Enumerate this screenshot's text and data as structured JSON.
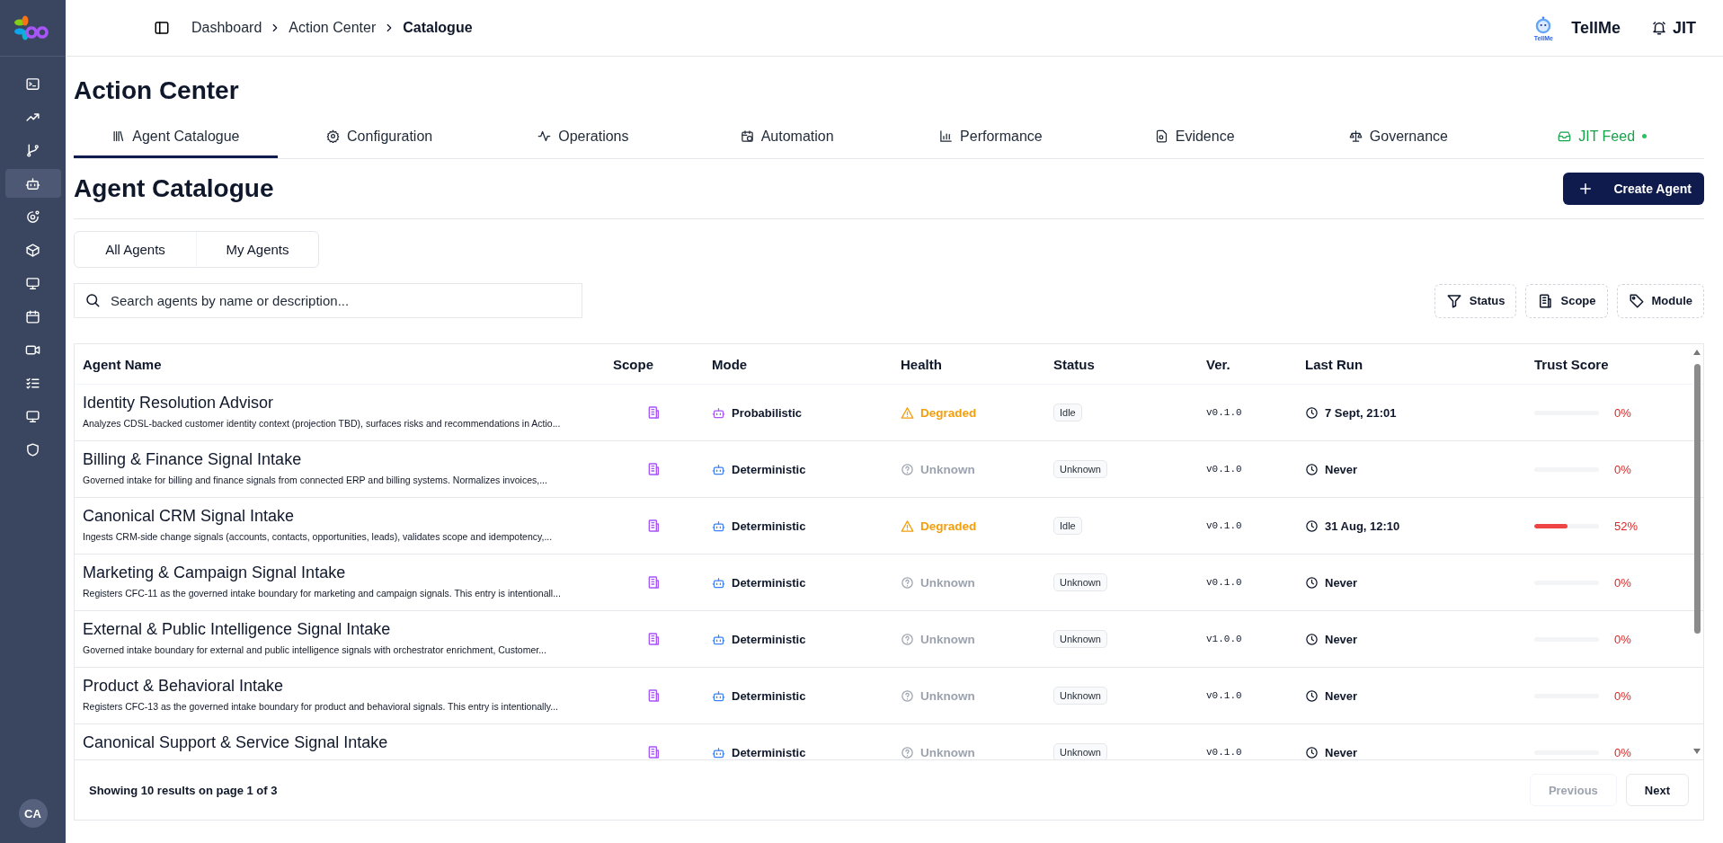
{
  "sidebar": {
    "items": [
      {
        "selected": false
      },
      {
        "selected": false
      },
      {
        "selected": false
      },
      {
        "selected": true
      },
      {
        "selected": false
      },
      {
        "selected": false
      },
      {
        "selected": false
      },
      {
        "selected": false
      },
      {
        "selected": false
      },
      {
        "selected": false
      },
      {
        "selected": false
      },
      {
        "selected": false
      }
    ],
    "avatar": "CA"
  },
  "breadcrumb": [
    {
      "label": "Dashboard",
      "current": false
    },
    {
      "label": "Action Center",
      "current": false
    },
    {
      "label": "Catalogue",
      "current": true
    }
  ],
  "header": {
    "assistant": {
      "logo_text": "TellMe",
      "label": "TellMe"
    },
    "alerts": {
      "label": "JIT"
    }
  },
  "page_title": "Action Center",
  "tabs": [
    {
      "label": "Agent Catalogue",
      "selected": true,
      "kind": "page"
    },
    {
      "label": "Configuration",
      "selected": false,
      "kind": "page"
    },
    {
      "label": "Operations",
      "selected": false,
      "kind": "page"
    },
    {
      "label": "Automation",
      "selected": false,
      "kind": "page"
    },
    {
      "label": "Performance",
      "selected": false,
      "kind": "page"
    },
    {
      "label": "Evidence",
      "selected": false,
      "kind": "page"
    },
    {
      "label": "Governance",
      "selected": false,
      "kind": "page"
    },
    {
      "label": "JIT Feed",
      "selected": false,
      "kind": "feed"
    }
  ],
  "section_title": "Agent Catalogue",
  "create_button": "Create Agent",
  "view_toggle": [
    "All Agents",
    "My Agents"
  ],
  "search": {
    "placeholder": "Search agents by name or description..."
  },
  "filters": [
    "Status",
    "Scope",
    "Module"
  ],
  "table": {
    "columns": [
      "Agent Name",
      "Scope",
      "Mode",
      "Health",
      "Status",
      "Ver.",
      "Last Run",
      "Trust Score"
    ],
    "rows": [
      {
        "name": "Identity Resolution Advisor",
        "description": "Analyzes CDSL-backed customer identity context (projection TBD), surfaces risks and recommendations in Actio...",
        "mode": {
          "label": "Probabilistic",
          "kind": "probabilistic"
        },
        "health": {
          "label": "Degraded",
          "kind": "degraded"
        },
        "status": "Idle",
        "version": "v0.1.0",
        "last_run": "7 Sept, 21:01",
        "trust": {
          "level": 0,
          "reading": "0%"
        }
      },
      {
        "name": "Billing & Finance Signal Intake",
        "description": "Governed intake for billing and finance signals from connected ERP and billing systems. Normalizes invoices,...",
        "mode": {
          "label": "Deterministic",
          "kind": "deterministic"
        },
        "health": {
          "label": "Unknown",
          "kind": "unknown"
        },
        "status": "Unknown",
        "version": "v0.1.0",
        "last_run": "Never",
        "trust": {
          "level": 0,
          "reading": "0%"
        }
      },
      {
        "name": "Canonical CRM Signal Intake",
        "description": "Ingests CRM-side change signals (accounts, contacts, opportunities, leads), validates scope and idempotency,...",
        "mode": {
          "label": "Deterministic",
          "kind": "deterministic"
        },
        "health": {
          "label": "Degraded",
          "kind": "degraded"
        },
        "status": "Idle",
        "version": "v0.1.0",
        "last_run": "31 Aug, 12:10",
        "trust": {
          "level": 0.52,
          "reading": "52%"
        }
      },
      {
        "name": "Marketing & Campaign Signal Intake",
        "description": "Registers CFC-11 as the governed intake boundary for marketing and campaign signals. This entry is intentionall...",
        "mode": {
          "label": "Deterministic",
          "kind": "deterministic"
        },
        "health": {
          "label": "Unknown",
          "kind": "unknown"
        },
        "status": "Unknown",
        "version": "v0.1.0",
        "last_run": "Never",
        "trust": {
          "level": 0,
          "reading": "0%"
        }
      },
      {
        "name": "External & Public Intelligence Signal Intake",
        "description": "Governed intake boundary for external and public intelligence signals with orchestrator enrichment, Customer...",
        "mode": {
          "label": "Deterministic",
          "kind": "deterministic"
        },
        "health": {
          "label": "Unknown",
          "kind": "unknown"
        },
        "status": "Unknown",
        "version": "v1.0.0",
        "last_run": "Never",
        "trust": {
          "level": 0,
          "reading": "0%"
        }
      },
      {
        "name": "Product & Behavioral Intake",
        "description": "Registers CFC-13 as the governed intake boundary for product and behavioral signals. This entry is intentionally...",
        "mode": {
          "label": "Deterministic",
          "kind": "deterministic"
        },
        "health": {
          "label": "Unknown",
          "kind": "unknown"
        },
        "status": "Unknown",
        "version": "v0.1.0",
        "last_run": "Never",
        "trust": {
          "level": 0,
          "reading": "0%"
        }
      },
      {
        "name": "Canonical Support & Service Signal Intake",
        "mode": {
          "label": "Deterministic",
          "kind": "deterministic"
        },
        "health": {
          "label": "Unknown",
          "kind": "unknown"
        },
        "status": "Unknown",
        "version": "v0.1.0",
        "last_run": "Never",
        "trust": {
          "level": 0,
          "reading": "0%"
        }
      }
    ]
  },
  "pagination": {
    "summary": "Showing 10 results on page 1 of 3",
    "previous": {
      "label": "Previous",
      "disabled": true
    },
    "next": {
      "label": "Next",
      "disabled": false
    }
  }
}
